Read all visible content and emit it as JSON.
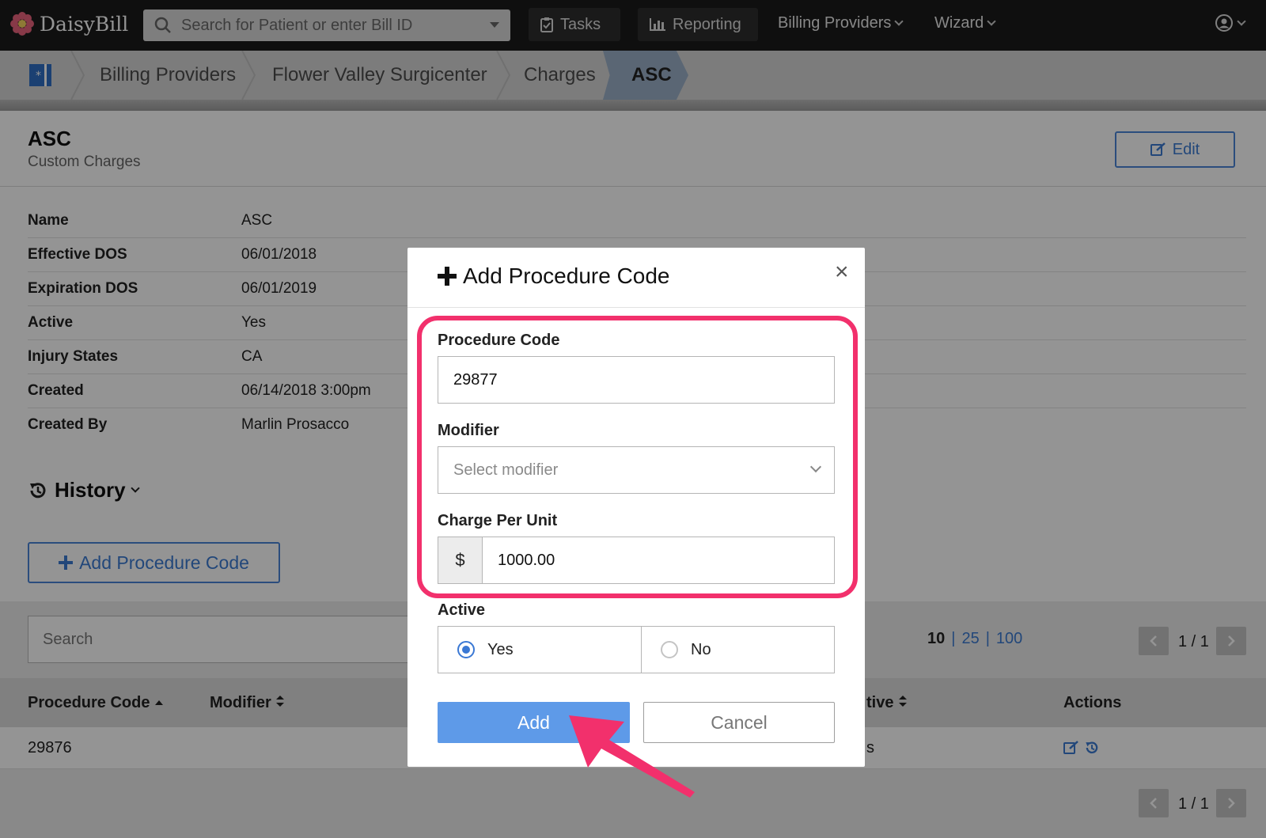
{
  "app": {
    "name": "DaisyBill"
  },
  "topnav": {
    "search_placeholder": "Search for Patient or enter Bill ID",
    "tasks_label": "Tasks",
    "reporting_label": "Reporting",
    "billing_providers_label": "Billing Providers",
    "wizard_label": "Wizard"
  },
  "breadcrumb": {
    "items": [
      "Billing Providers",
      "Flower Valley Surgicenter",
      "Charges"
    ],
    "current": "ASC"
  },
  "page": {
    "title": "ASC",
    "subtitle": "Custom Charges",
    "edit_label": "Edit"
  },
  "details": [
    {
      "key": "Name",
      "value": "ASC"
    },
    {
      "key": "Effective DOS",
      "value": "06/01/2018"
    },
    {
      "key": "Expiration DOS",
      "value": "06/01/2019"
    },
    {
      "key": "Active",
      "value": "Yes"
    },
    {
      "key": "Injury States",
      "value": "CA"
    },
    {
      "key": "Created",
      "value": "06/14/2018 3:00pm"
    },
    {
      "key": "Created By",
      "value": "Marlin Prosacco"
    }
  ],
  "history_label": "History",
  "add_procedure_code_label": "Add Procedure Code",
  "table": {
    "search_placeholder": "Search",
    "page_sizes": [
      "10",
      "25",
      "100"
    ],
    "page_sizes_sep": "|",
    "pagination": "1 / 1",
    "headers": {
      "procedure_code": "Procedure Code",
      "modifier": "Modifier",
      "active": "tive",
      "actions": "Actions"
    },
    "rows": [
      {
        "procedure_code": "29876",
        "active": "s"
      }
    ]
  },
  "modal": {
    "title": "Add Procedure Code",
    "close": "×",
    "procedure_code_label": "Procedure Code",
    "procedure_code_value": "29877",
    "modifier_label": "Modifier",
    "modifier_placeholder": "Select modifier",
    "charge_label": "Charge Per Unit",
    "currency": "$",
    "charge_value": "1000.00",
    "active_label": "Active",
    "yes_label": "Yes",
    "no_label": "No",
    "active_selected": "Yes",
    "add_label": "Add",
    "cancel_label": "Cancel"
  },
  "colors": {
    "accent": "#3c7bd2",
    "highlight": "#f2306c",
    "topbar": "#1b1b1b"
  }
}
